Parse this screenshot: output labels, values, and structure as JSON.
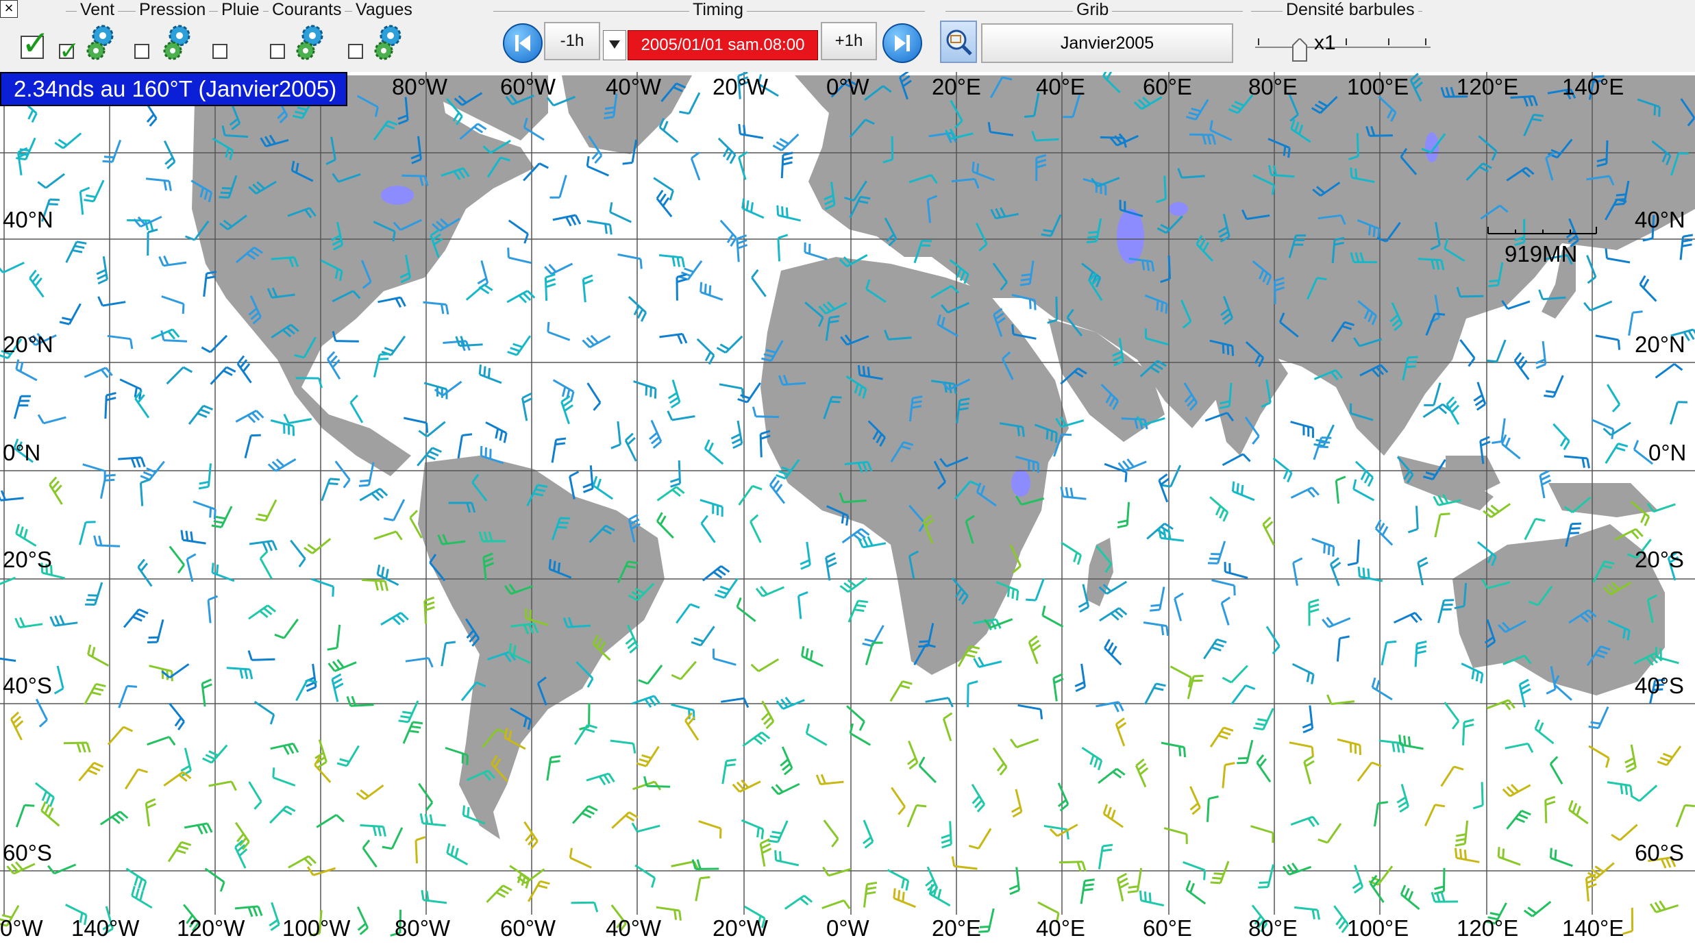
{
  "window": {
    "close_label": "×"
  },
  "toolbar": {
    "vent_label": "Vent",
    "pression_label": "Pression",
    "pluie_label": "Pluie",
    "courants_label": "Courants",
    "vagues_label": "Vagues",
    "timing_label": "Timing",
    "minus_label": "-1h",
    "date_value": "2005/01/01 sam.08:00",
    "plus_label": "+1h",
    "grib_label": "Grib",
    "grib_value": "Janvier2005",
    "density_label": "Densité barbules",
    "density_value": "x1",
    "checks": {
      "vent_main": true,
      "vent": true,
      "pression": false,
      "pluie": false,
      "courants": false,
      "vagues": false
    }
  },
  "map": {
    "info_banner": "2.34nds au 160°T (Janvier2005)",
    "top_lon_labels": [
      "80°W",
      "60°W",
      "40°W",
      "20°W",
      "0°W",
      "20°E",
      "40°E",
      "60°E",
      "80°E",
      "100°E",
      "120°E",
      "140°E"
    ],
    "bottom_lon_labels": [
      "0°W",
      "140°W",
      "120°W",
      "100°W",
      "80°W",
      "60°W",
      "40°W",
      "20°W",
      "0°W",
      "20°E",
      "40°E",
      "60°E",
      "80°E",
      "100°E",
      "120°E",
      "140°E"
    ],
    "left_lat_labels": [
      "40°N",
      "20°N",
      "0°N",
      "20°S",
      "40°S",
      "60°S"
    ],
    "right_lat_labels": [
      "40°N",
      "20°N",
      "0°N",
      "20°S",
      "40°S",
      "60°S"
    ],
    "scale_label": "919MN",
    "colors": {
      "land": "#a0a0a0",
      "lake": "#8c8cff",
      "grid": "#555555",
      "ocean": "#ffffff"
    }
  }
}
